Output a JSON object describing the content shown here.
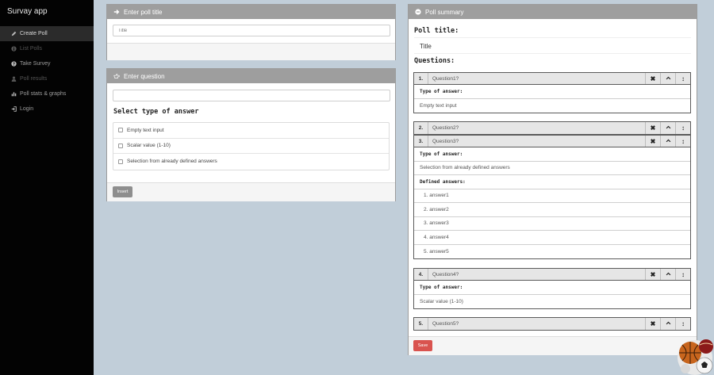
{
  "app": {
    "title": "Survay app"
  },
  "sidebar": {
    "items": [
      {
        "label": "Create Poll",
        "icon": "pencil-icon",
        "state": "active"
      },
      {
        "label": "List Polls",
        "icon": "info-circle-icon",
        "state": "disabled"
      },
      {
        "label": "Take Survey",
        "icon": "question-circle-icon",
        "state": "normal"
      },
      {
        "label": "Poll results",
        "icon": "user-icon",
        "state": "disabled"
      },
      {
        "label": "Poll stats & graphs",
        "icon": "bar-chart-icon",
        "state": "normal"
      },
      {
        "label": "Login",
        "icon": "login-icon",
        "state": "normal"
      }
    ]
  },
  "poll_title_panel": {
    "heading": "Enter poll title",
    "icon": "arrow-right-icon",
    "input_placeholder": "Title"
  },
  "question_panel": {
    "heading": "Enter question",
    "icon": "hand-right-icon",
    "question_value": "",
    "answer_type_heading": "Select type of answer",
    "answer_types": [
      "Empty text input",
      "Scalar value (1-10)",
      "Selection from already defined answers"
    ],
    "insert_label": "Insert"
  },
  "summary": {
    "heading": "Poll summary",
    "icon": "minus-circle-icon",
    "poll_title_label": "Poll title:",
    "poll_title_value": "Title",
    "questions_label": "Questions:",
    "type_label": "Type of answer:",
    "defined_label": "Defined answers:",
    "controls": {
      "remove": "✖",
      "up": "︿",
      "move": "↕"
    },
    "questions": [
      {
        "num": "1.",
        "title": "Question1?",
        "type": "Empty text input"
      },
      {
        "num": "2.",
        "title": "Question2?"
      },
      {
        "num": "3.",
        "title": "Question3?",
        "type": "Selection from already defined answers",
        "answers": [
          "1. answer1",
          "2. answer2",
          "3. answer3",
          "4. answer4",
          "5. answer5"
        ]
      },
      {
        "num": "4.",
        "title": "Question4?",
        "type": "Scalar value (1-10)"
      },
      {
        "num": "5.",
        "title": "Question5?"
      }
    ],
    "save_label": "Save"
  },
  "colors": {
    "sidebar_bg": "#030303",
    "page_bg": "#c1ced9",
    "panel_head": "#9e9e9e",
    "save": "#d9534f"
  }
}
